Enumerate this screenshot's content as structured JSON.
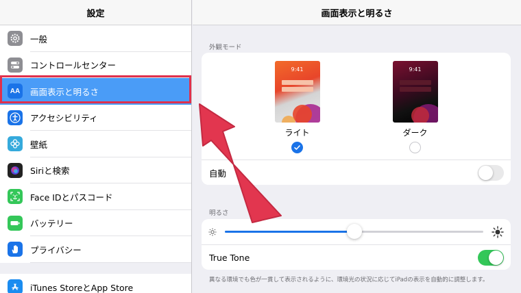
{
  "sidebar": {
    "title": "設定",
    "items": [
      {
        "label": "一般",
        "icon": "gear-icon",
        "color": "#8e8e93"
      },
      {
        "label": "コントロールセンター",
        "icon": "switches-icon",
        "color": "#8e8e93"
      },
      {
        "label": "画面表示と明るさ",
        "icon": "text-size-icon",
        "color": "#1a73e8",
        "glyph": "AA"
      },
      {
        "label": "アクセシビリティ",
        "icon": "accessibility-icon",
        "color": "#1a73e8"
      },
      {
        "label": "壁紙",
        "icon": "flower-icon",
        "color": "#35aadc"
      },
      {
        "label": "Siriと検索",
        "icon": "siri-icon",
        "color": "#222"
      },
      {
        "label": "Face IDとパスコード",
        "icon": "face-id-icon",
        "color": "#34c759"
      },
      {
        "label": "バッテリー",
        "icon": "battery-icon",
        "color": "#34c759"
      },
      {
        "label": "プライバシー",
        "icon": "hand-icon",
        "color": "#1a73e8"
      }
    ],
    "bottom_item": {
      "label": "iTunes StoreとApp Store",
      "icon": "app-store-icon",
      "color": "#1a8cf0"
    }
  },
  "main": {
    "title": "画面表示と明るさ",
    "appearance_section": "外観モード",
    "modes": [
      {
        "label": "ライト",
        "time": "9:41",
        "selected": true
      },
      {
        "label": "ダーク",
        "time": "9:41",
        "selected": false
      }
    ],
    "auto_label": "自動",
    "auto_on": false,
    "brightness_section": "明るさ",
    "brightness_level": 0.5,
    "true_tone_label": "True Tone",
    "true_tone_on": true,
    "footnote": "異なる環境でも色が一貫して表示されるように、環境光の状況に応じてiPadの表示を自動的に調整します。"
  },
  "colors": {
    "accent": "#1a73e8",
    "selection": "#4a9cf7",
    "highlight": "#e0304c",
    "toggle_on": "#34c759"
  }
}
